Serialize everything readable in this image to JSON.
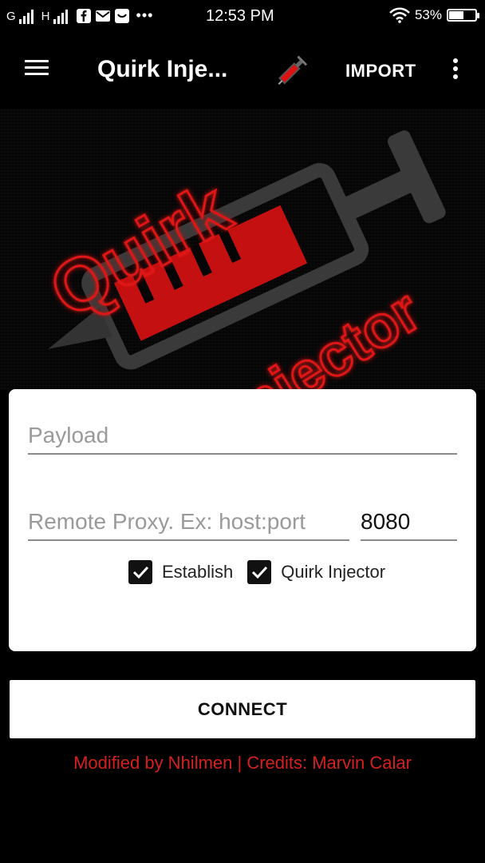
{
  "status_bar": {
    "network_1": "G",
    "network_2": "H",
    "overflow": "•••",
    "time": "12:53 PM",
    "battery": "53%",
    "icons": [
      "signal-icon",
      "facebook-icon",
      "mail-icon",
      "notification-icon",
      "wifi-icon",
      "battery-icon"
    ]
  },
  "toolbar": {
    "title": "Quirk Inje...",
    "import_label": "IMPORT",
    "icons": [
      "menu-icon",
      "syringe-icon",
      "overflow-menu-icon"
    ]
  },
  "banner": {
    "logo_text_1": "Quirk",
    "logo_text_2": "Injector"
  },
  "form": {
    "payload_placeholder": "Payload",
    "proxy_placeholder": "Remote Proxy. Ex: host:port",
    "port_value": "8080",
    "checkboxes": [
      {
        "label": "Establish",
        "checked": true
      },
      {
        "label": "Quirk Injector",
        "checked": true
      }
    ]
  },
  "connect_label": "CONNECT",
  "credits": "Modified by Nhilmen | Credits: Marvin Calar",
  "colors": {
    "background": "#000000",
    "accent_red": "#d62020",
    "card": "#ffffff"
  }
}
